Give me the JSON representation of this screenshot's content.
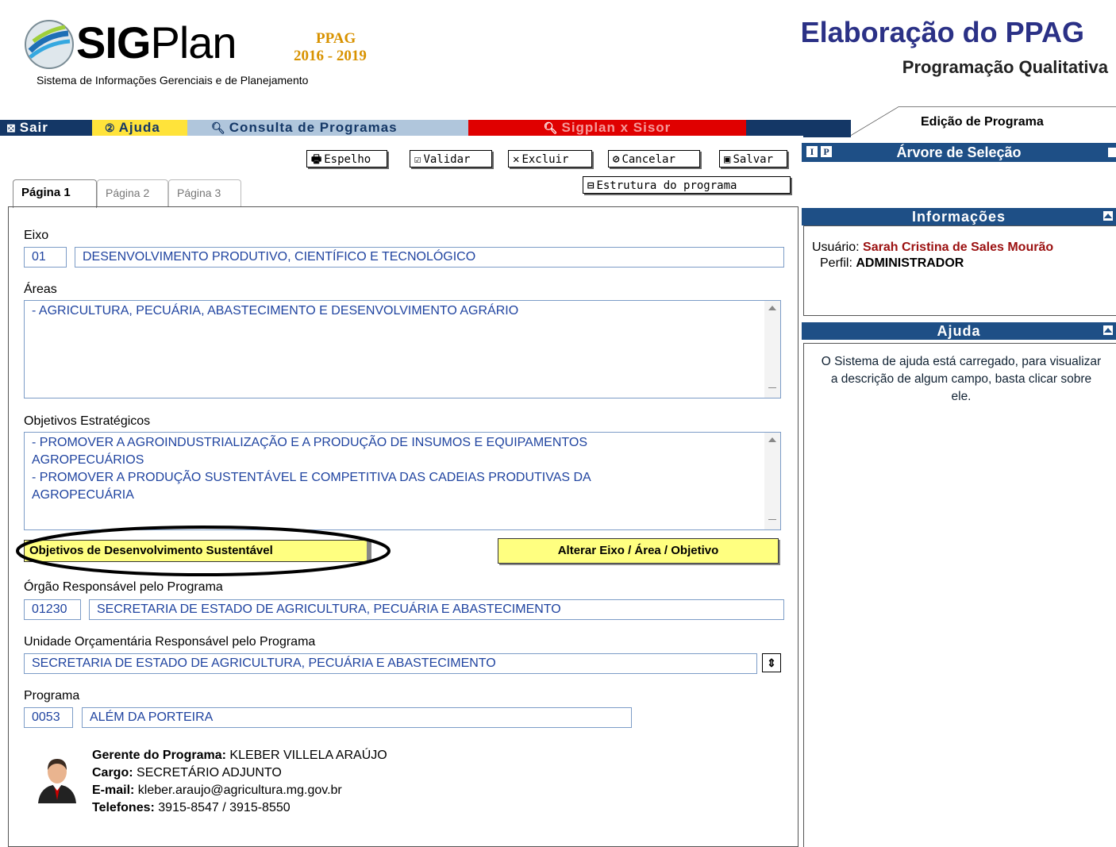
{
  "header": {
    "logo_name": "SIGPlan",
    "logo_bold": "SIG",
    "logo_light": "Plan",
    "ppag_label": "PPAG",
    "ppag_years": "2016 - 2019",
    "logo_subtitle": "Sistema de Informações Gerenciais e de Planejamento",
    "title": "Elaboração do PPAG",
    "subtitle": "Programação Qualitativa"
  },
  "menu": {
    "sair": "Sair",
    "ajuda": "Ajuda",
    "consulta": "Consulta de Programas",
    "sisor": "Sigplan x Sisor"
  },
  "right_tab": "Edição de Programa",
  "toolbar": {
    "espelho": "Espelho",
    "validar": "Validar",
    "excluir": "Excluir",
    "cancelar": "Cancelar",
    "salvar": "Salvar",
    "estrutura": "Estrutura do programa"
  },
  "tabs": [
    "Página 1",
    "Página 2",
    "Página 3"
  ],
  "form": {
    "eixo_label": "Eixo",
    "eixo_code": "01",
    "eixo_value": "DESENVOLVIMENTO PRODUTIVO, CIENTÍFICO E TECNOLÓGICO",
    "areas_label": "Áreas",
    "areas_value": "- AGRICULTURA, PECUÁRIA, ABASTECIMENTO E DESENVOLVIMENTO AGRÁRIO",
    "objetivos_label": "Objetivos Estratégicos",
    "objetivos_lines": [
      "- PROMOVER A AGROINDUSTRIALIZAÇÃO E A PRODUÇÃO DE INSUMOS E EQUIPAMENTOS",
      "AGROPECUÁRIOS",
      "- PROMOVER A PRODUÇÃO SUSTENTÁVEL E COMPETITIVA DAS CADEIAS PRODUTIVAS DA",
      "AGROPECUÁRIA"
    ],
    "ods_button": "Objetivos de Desenvolvimento Sustentável",
    "alterar_button": "Alterar Eixo / Área / Objetivo",
    "orgao_label": "Órgão Responsável pelo Programa",
    "orgao_code": "01230",
    "orgao_value": "SECRETARIA DE ESTADO DE AGRICULTURA, PECUÁRIA E ABASTECIMENTO",
    "unidade_label": "Unidade Orçamentária Responsável pelo Programa",
    "unidade_value": "SECRETARIA DE ESTADO DE AGRICULTURA, PECUÁRIA E ABASTECIMENTO",
    "programa_label": "Programa",
    "programa_code": "0053",
    "programa_value": "ALÉM DA PORTEIRA"
  },
  "gerente": {
    "nome_label": "Gerente do Programa:",
    "nome": "KLEBER VILLELA ARAÚJO",
    "cargo_label": "Cargo:",
    "cargo": "SECRETÁRIO ADJUNTO",
    "email_label": "E-mail:",
    "email": "kleber.araujo@agricultura.mg.gov.br",
    "telefones_label": "Telefones:",
    "telefones": "3915-8547 / 3915-8550"
  },
  "right": {
    "ip_i": "I",
    "ip_p": "P",
    "arvore_title": "Árvore de Seleção",
    "info_title": "Informações",
    "usuario_label": "Usuário:",
    "usuario": "Sarah Cristina de Sales Mourão",
    "perfil_label": "Perfil:",
    "perfil": "ADMINISTRADOR",
    "ajuda_title": "Ajuda",
    "ajuda_text": "O Sistema de ajuda está carregado, para visualizar a descrição de algum campo, basta clicar sobre ele."
  },
  "colors": {
    "menu_bar": "#143766",
    "ajuda_bg": "#ffe33a",
    "consulta_bg": "#b0c6dc",
    "sisor_bg": "#e00000",
    "panel_header": "#1e4f86",
    "field_text": "#2044a0",
    "highlight_button": "#ffff80",
    "title_color": "#2b3186"
  }
}
